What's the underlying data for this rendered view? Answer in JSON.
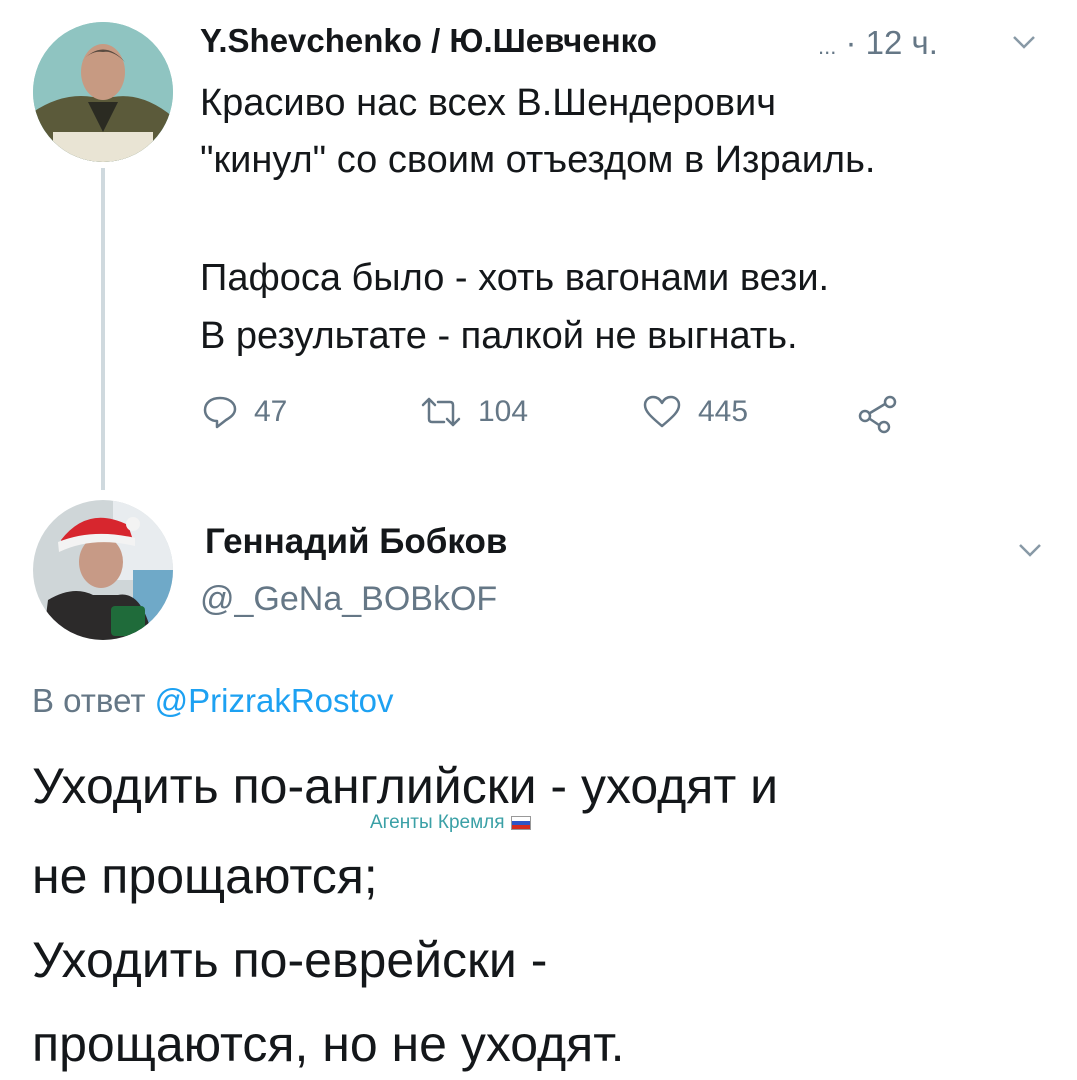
{
  "tweet1": {
    "author": "Y.Shevchenko / Ю.Шевченко",
    "ellipsis": "...",
    "time": "· 12 ч.",
    "lines": [
      "Красиво нас всех В.Шендерович",
      "\"кинул\" со своим отъездом в Израиль.",
      "Пафоса было - хоть вагонами вези.",
      "В результате - палкой не выгнать."
    ],
    "replies": "47",
    "retweets": "104",
    "likes": "445"
  },
  "tweet2": {
    "author": "Геннадий Бобков",
    "handle": "@_GeNa_BOBkOF",
    "reply_prefix": "В ответ",
    "reply_to": "@PrizrakRostov",
    "lines": [
      "Уходить по-английски - уходят и",
      "не прощаются;",
      "Уходить по-еврейски -",
      "прощаются, но не уходят."
    ]
  },
  "watermark": "Агенты Кремля",
  "colors": {
    "text": "#14171a",
    "secondary": "#657786",
    "link": "#1da1f2",
    "thread_line": "#cfd9de"
  },
  "icons": [
    "reply-icon",
    "retweet-icon",
    "like-icon",
    "share-icon",
    "chevron-down-icon"
  ]
}
